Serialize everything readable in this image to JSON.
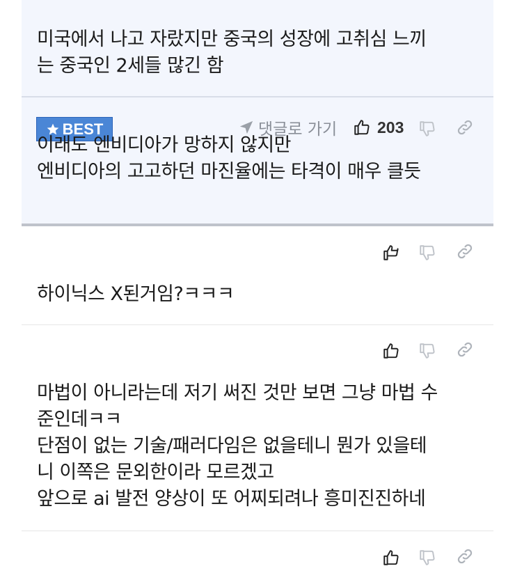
{
  "comments_top": {
    "first": {
      "lines": [
        "미국에서 나고 자랐지만 중국의 성장에 고취심 느끼",
        "는 중국인 2세들 많긴 함"
      ]
    },
    "best": {
      "badge": "BEST",
      "goto_label": "댓글로 가기",
      "like_count": "203",
      "lines": [
        "이래도 엔비디아가 망하지 않지만",
        "엔비디아의 고고하던 마진율에는 타격이 매우 클듯"
      ]
    }
  },
  "comments": [
    {
      "lines": [
        "하이닉스 X된거임?ㅋㅋㅋ"
      ]
    },
    {
      "lines": [
        "마법이 아니라는데 저기 써진 것만 보면 그냥 마법 수",
        "준인데ㅋㅋ",
        "단점이 없는 기술/패러다임은 없을테니 뭔가 있을테",
        "니 이쪽은 문외한이라 모르겠고",
        "앞으로 ai 발전 양상이 또 어찌되려나 흥미진진하네"
      ]
    }
  ],
  "icons": {
    "like": "thumbs-up-icon",
    "dislike": "thumbs-down-icon",
    "link": "link-icon",
    "star": "star-icon",
    "goto": "arrow-icon"
  },
  "colors": {
    "best_bg": "#f3f6fd",
    "badge": "#4a86d6",
    "muted": "#8a8f98"
  }
}
